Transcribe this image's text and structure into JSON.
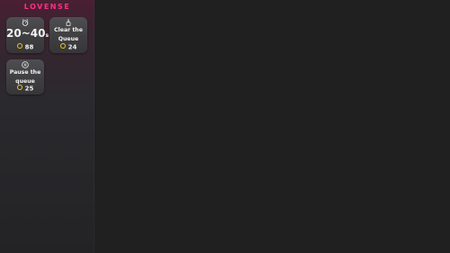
{
  "panel": {
    "brand": "LOVENSE",
    "brand_color": "#ff2f86",
    "coin_color": "#f5c518"
  },
  "cards": [
    {
      "icon": "timer-icon",
      "value": "20~40",
      "unit": "s",
      "cost": "88"
    },
    {
      "icon": "broom-icon",
      "label_line1": "Clear the",
      "label_line2": "Queue",
      "cost": "24"
    },
    {
      "icon": "pause-icon",
      "label_line1": "Pause the",
      "label_line2": "queue",
      "cost": "25"
    }
  ]
}
